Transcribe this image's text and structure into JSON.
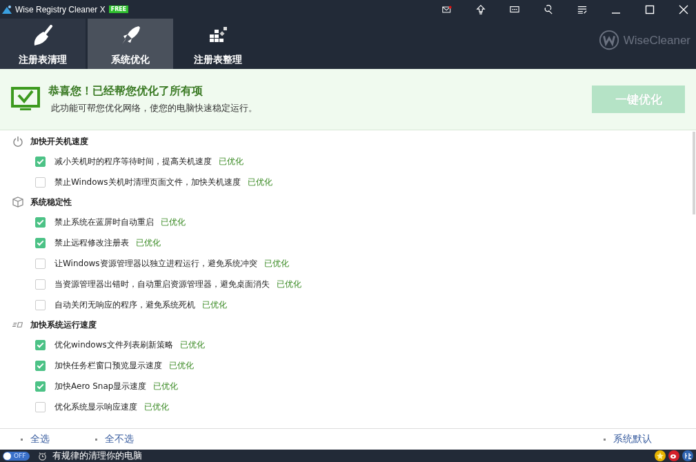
{
  "window": {
    "title": "Wise Registry Cleaner X",
    "badge": "FREE"
  },
  "tabs": [
    {
      "label": "注册表清理",
      "selected": false
    },
    {
      "label": "系统优化",
      "selected": true
    },
    {
      "label": "注册表整理",
      "selected": false
    }
  ],
  "brand": "WiseCleaner",
  "banner": {
    "title": "恭喜您！已经帮您优化了所有项",
    "subtitle": "此功能可帮您优化网络，使您的电脑快速稳定运行。",
    "button": {
      "label": "一键优化",
      "disabled": true
    }
  },
  "sections": [
    {
      "title": "加快开关机速度",
      "kind": "power",
      "items": [
        {
          "label": "减小关机时的程序等待时间，提高关机速度",
          "status": "已优化",
          "checked": true
        },
        {
          "label": "禁止Windows关机时清理页面文件，加快关机速度",
          "status": "已优化",
          "checked": false
        }
      ]
    },
    {
      "title": "系统稳定性",
      "kind": "box",
      "items": [
        {
          "label": "禁止系统在蓝屏时自动重启",
          "status": "已优化",
          "checked": true
        },
        {
          "label": "禁止远程修改注册表",
          "status": "已优化",
          "checked": true
        },
        {
          "label": "让Windows资源管理器以独立进程运行，避免系统冲突",
          "status": "已优化",
          "checked": false
        },
        {
          "label": "当资源管理器出错时，自动重启资源管理器，避免桌面消失",
          "status": "已优化",
          "checked": false
        },
        {
          "label": "自动关闭无响应的程序，避免系统死机",
          "status": "已优化",
          "checked": false
        }
      ]
    },
    {
      "title": "加快系统运行速度",
      "kind": "speed",
      "items": [
        {
          "label": "优化windows文件列表刷新策略",
          "status": "已优化",
          "checked": true
        },
        {
          "label": "加快任务栏窗口预览显示速度",
          "status": "已优化",
          "checked": true
        },
        {
          "label": "加快Aero Snap显示速度",
          "status": "已优化",
          "checked": true
        },
        {
          "label": "优化系统显示响应速度",
          "status": "已优化",
          "checked": false
        }
      ]
    }
  ],
  "footer_links": {
    "left": [
      "全选",
      "全不选"
    ],
    "right": "系统默认"
  },
  "status_bar": {
    "toggle": {
      "label": "OFF",
      "on": false
    },
    "text": "有规律的清理你的电脑"
  }
}
